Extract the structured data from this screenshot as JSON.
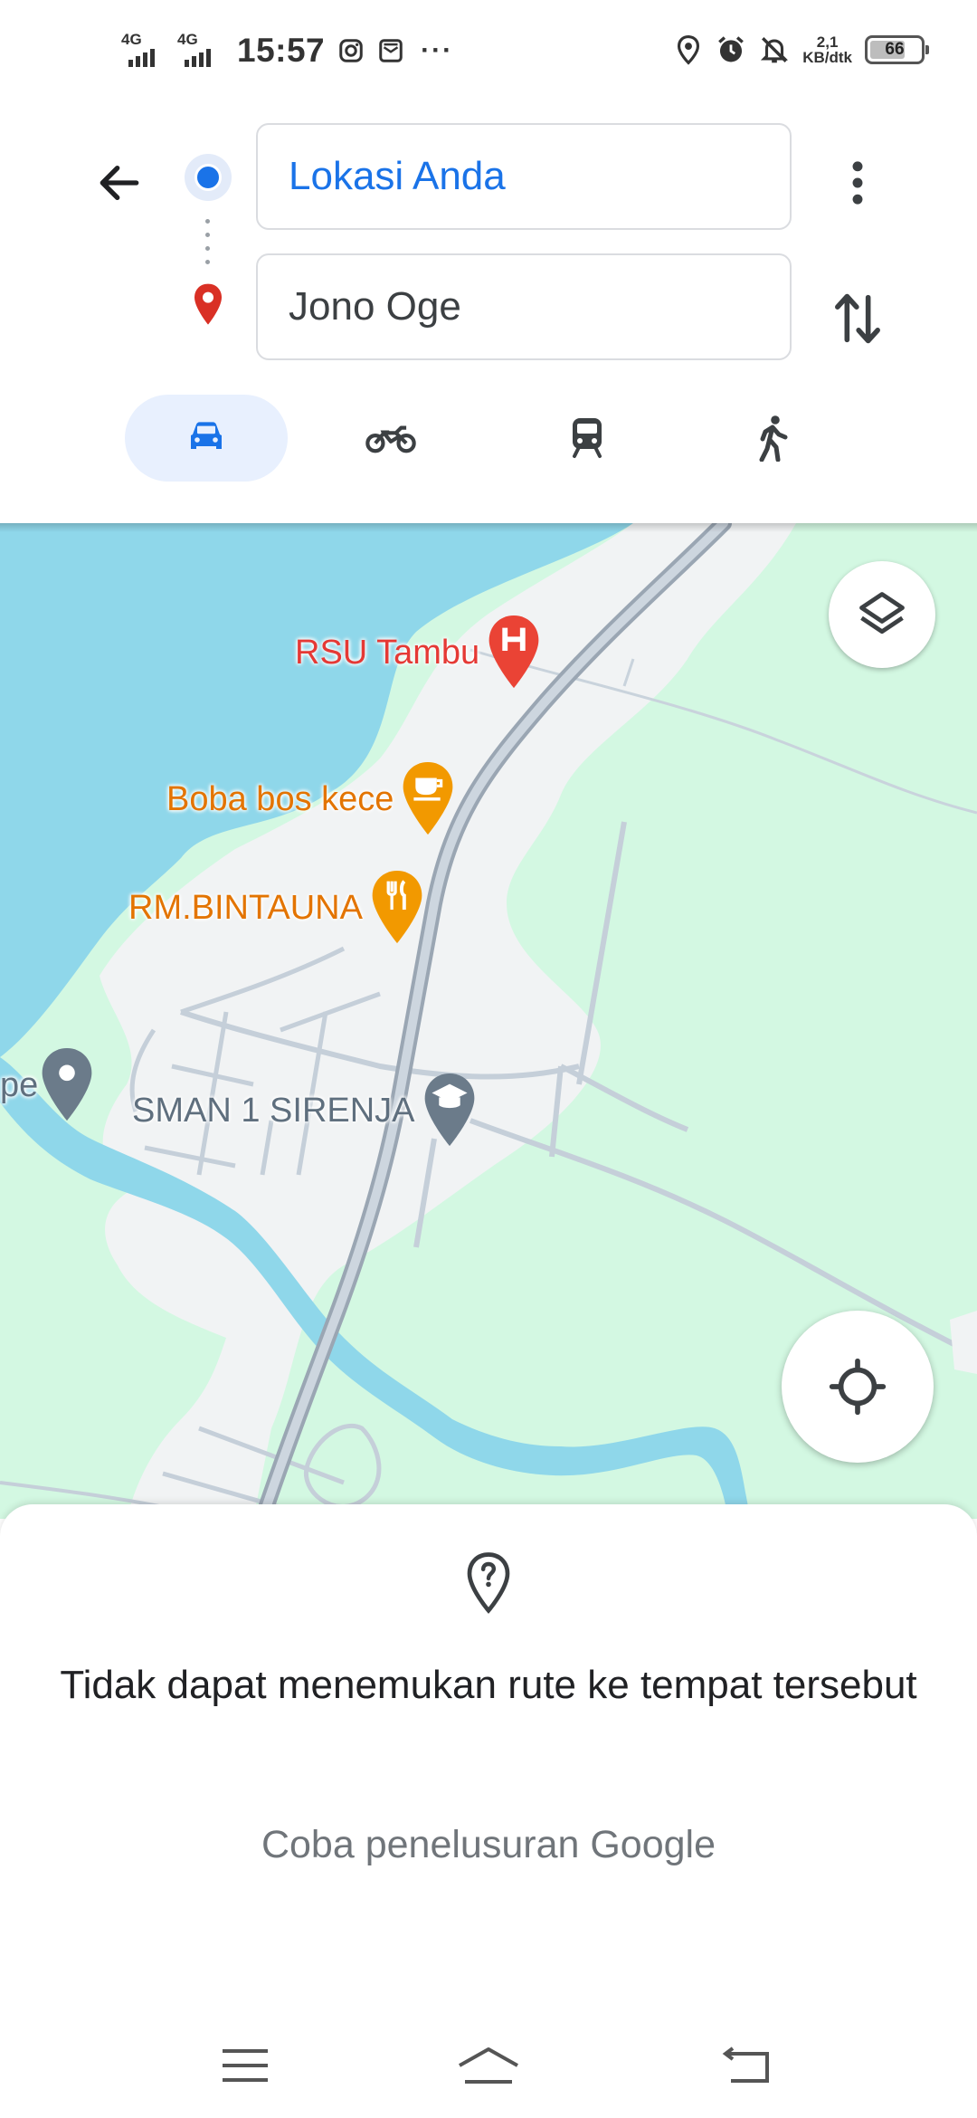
{
  "status_bar": {
    "network_1": "4G",
    "network_2": "4G",
    "time": "15:57",
    "more": "···",
    "speed_value": "2,1",
    "speed_unit": "KB/dtk",
    "battery": "66",
    "icons": [
      "instagram-icon",
      "message-app-icon",
      "location-icon",
      "alarm-icon",
      "bell-off-icon"
    ]
  },
  "directions": {
    "origin": "Lokasi Anda",
    "destination": "Jono Oge",
    "modes": [
      {
        "icon": "car-icon",
        "selected": true
      },
      {
        "icon": "motorcycle-icon",
        "selected": false
      },
      {
        "icon": "transit-icon",
        "selected": false
      },
      {
        "icon": "walk-icon",
        "selected": false
      }
    ]
  },
  "map": {
    "pois": [
      {
        "label": "RSU Tambu",
        "type": "hospital",
        "color": "#e53935"
      },
      {
        "label": "Boba bos kece",
        "type": "cafe",
        "color": "#e37400"
      },
      {
        "label": "RM.BINTAUNA",
        "type": "restaurant",
        "color": "#e37400"
      },
      {
        "label": "SMAN 1 SIRENJA",
        "type": "school",
        "color": "#5f6f7e"
      },
      {
        "label": "pe",
        "type": "place",
        "color": "#5f6f7e"
      }
    ],
    "colors": {
      "water": "#8fd7ea",
      "land": "#d3f8e2",
      "urban": "#f1f3f4",
      "road": "#b8c4d1"
    }
  },
  "sheet": {
    "title": "Tidak dapat menemukan rute ke tempat tersebut",
    "subtitle": "Coba penelusuran Google"
  },
  "accent": "#1a73e8"
}
